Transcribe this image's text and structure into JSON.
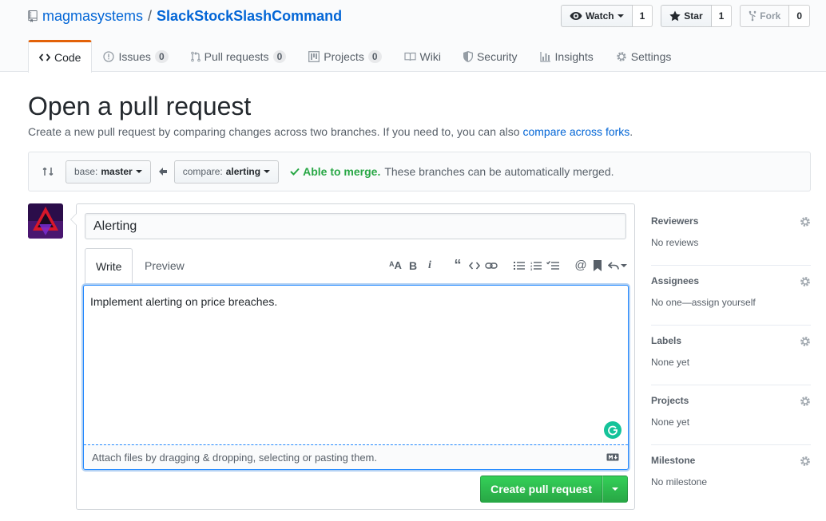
{
  "repo": {
    "owner": "magmasystems",
    "separator": "/",
    "name": "SlackStockSlashCommand"
  },
  "actions": {
    "watch": {
      "label": "Watch",
      "count": "1"
    },
    "star": {
      "label": "Star",
      "count": "1"
    },
    "fork": {
      "label": "Fork",
      "count": "0"
    }
  },
  "nav": [
    {
      "label": "Code",
      "icon": "code-icon",
      "count": null,
      "selected": true
    },
    {
      "label": "Issues",
      "icon": "issue-icon",
      "count": "0"
    },
    {
      "label": "Pull requests",
      "icon": "pull-request-icon",
      "count": "0"
    },
    {
      "label": "Projects",
      "icon": "project-icon",
      "count": "0"
    },
    {
      "label": "Wiki",
      "icon": "book-icon",
      "count": null
    },
    {
      "label": "Security",
      "icon": "shield-icon",
      "count": null
    },
    {
      "label": "Insights",
      "icon": "graph-icon",
      "count": null
    },
    {
      "label": "Settings",
      "icon": "gear-icon",
      "count": null
    }
  ],
  "page": {
    "title": "Open a pull request",
    "description": "Create a new pull request by comparing changes across two branches. If you need to, you can also ",
    "description_link": "compare across forks",
    "description_end": "."
  },
  "range": {
    "base_prefix": "base:",
    "base_branch": "master",
    "compare_prefix": "compare:",
    "compare_branch": "alerting",
    "merge_status": "Able to merge.",
    "merge_message": "These branches can be automatically merged."
  },
  "form": {
    "title_value": "Alerting",
    "tabs": {
      "write": "Write",
      "preview": "Preview"
    },
    "body": "Implement alerting on price breaches.",
    "attach_hint": "Attach files by dragging & dropping, selecting or pasting them.",
    "submit_label": "Create pull request"
  },
  "sidebar": [
    {
      "heading": "Reviewers",
      "value": "No reviews"
    },
    {
      "heading": "Assignees",
      "value": "No one—assign yourself"
    },
    {
      "heading": "Labels",
      "value": "None yet"
    },
    {
      "heading": "Projects",
      "value": "None yet"
    },
    {
      "heading": "Milestone",
      "value": "No milestone"
    }
  ],
  "colors": {
    "link": "#0366d6",
    "success": "#28a745",
    "tab_accent": "#e36209"
  }
}
